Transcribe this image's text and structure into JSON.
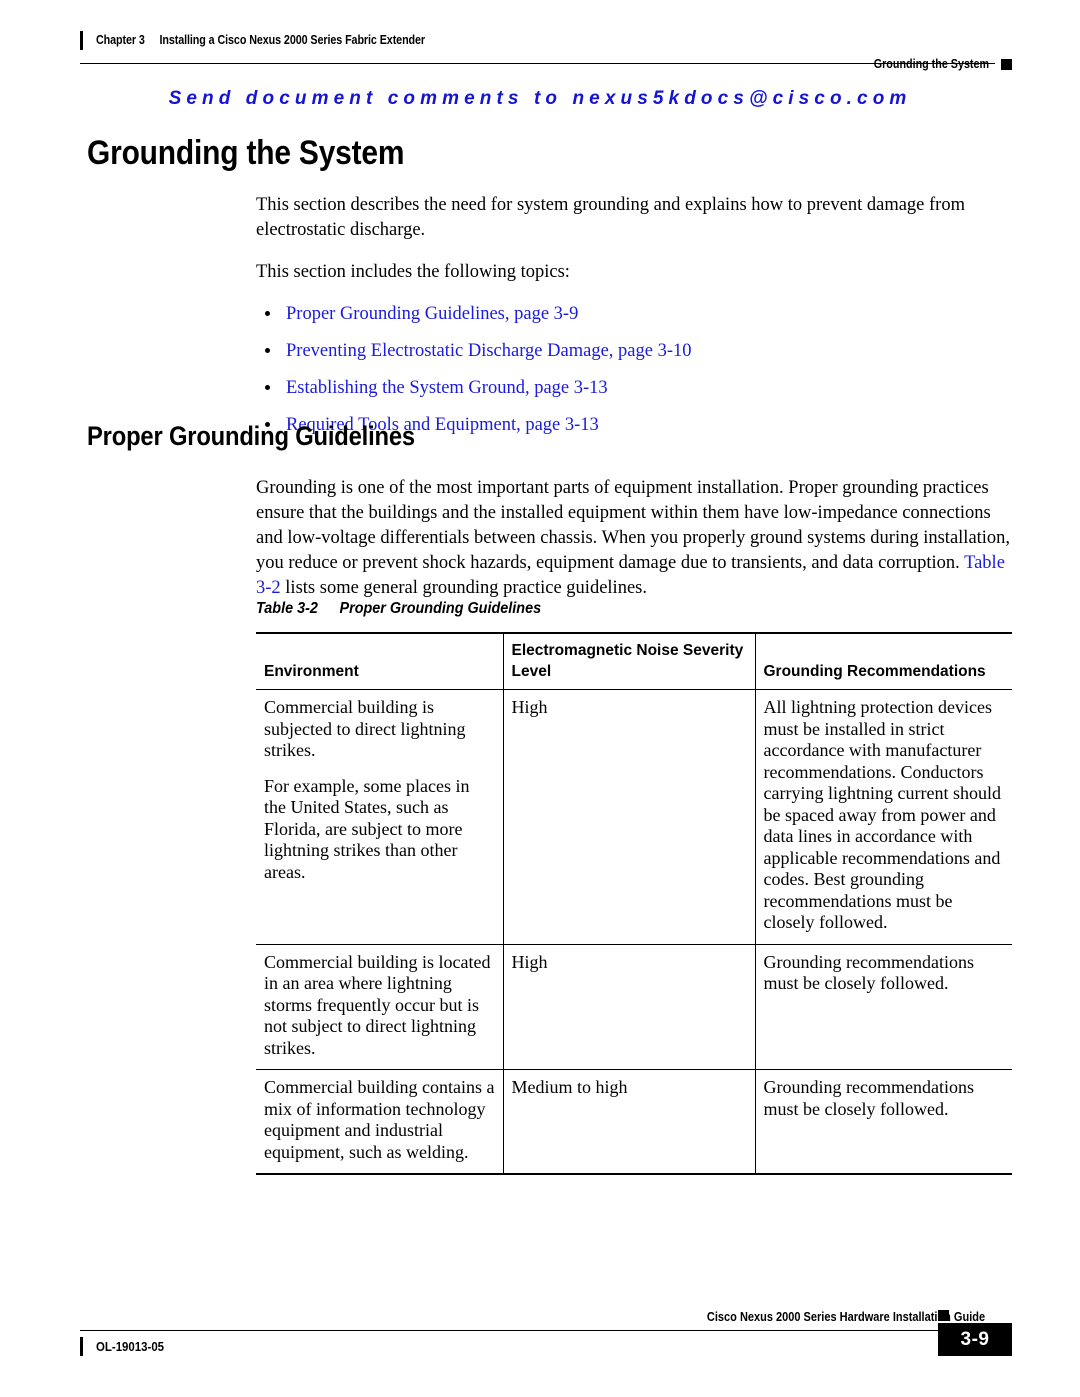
{
  "header": {
    "chapter_number": "Chapter 3",
    "chapter_title": "Installing a Cisco Nexus 2000 Series Fabric Extender",
    "section_name": "Grounding the System"
  },
  "comment_banner": {
    "text": "Send document comments to nexus5kdocs@cisco.com",
    "color": "#1414d2"
  },
  "sections": {
    "main_heading": "Grounding the System",
    "intro_paragraph": "This section describes the need for system grounding and explains how to prevent damage from electrostatic discharge.",
    "topics_lead_in": "This section includes the following topics:",
    "topics": [
      "Proper Grounding Guidelines, page 3-9",
      "Preventing Electrostatic Discharge Damage, page 3-10",
      "Establishing the System Ground, page 3-13",
      "Required Tools and Equipment, page 3-13"
    ],
    "sub_heading": "Proper Grounding Guidelines",
    "sub_paragraph_part1": "Grounding is one of the most important parts of equipment installation. Proper grounding practices ensure that the buildings and the installed equipment within them have low-impedance connections and low-voltage differentials between chassis. When you properly ground systems during installation, you reduce or prevent shock hazards, equipment damage due to transients, and data corruption. ",
    "sub_paragraph_xref": "Table 3-2",
    "sub_paragraph_part2": " lists some general grounding practice guidelines."
  },
  "table": {
    "caption_number": "Table 3-2",
    "caption_title": "Proper Grounding Guidelines",
    "headers": [
      "Environment",
      "Electromagnetic Noise Severity Level",
      "Grounding Recommendations"
    ],
    "rows": [
      {
        "environment_p1": "Commercial building is subjected to direct lightning strikes.",
        "environment_p2": "For example, some places in the United States, such as Florida, are subject to more lightning strikes than other areas.",
        "noise_level": "High",
        "recommendations": "All lightning protection devices must be installed in strict accordance with manufacturer recommendations. Conductors carrying lightning current should be spaced away from power and data lines in accordance with applicable recommendations and codes. Best grounding recommendations must be closely followed."
      },
      {
        "environment_p1": "Commercial building is located in an area where lightning storms frequently occur but is not subject to direct lightning strikes.",
        "environment_p2": "",
        "noise_level": "High",
        "recommendations": "Grounding recommendations must be closely followed."
      },
      {
        "environment_p1": "Commercial building contains a mix of information technology equipment and industrial equipment, such as welding.",
        "environment_p2": "",
        "noise_level": "Medium to high",
        "recommendations": "Grounding recommendations must be closely followed."
      }
    ]
  },
  "footer": {
    "guide_title": "Cisco Nexus 2000 Series Hardware Installation Guide",
    "document_id": "OL-19013-05",
    "page_number": "3-9"
  }
}
